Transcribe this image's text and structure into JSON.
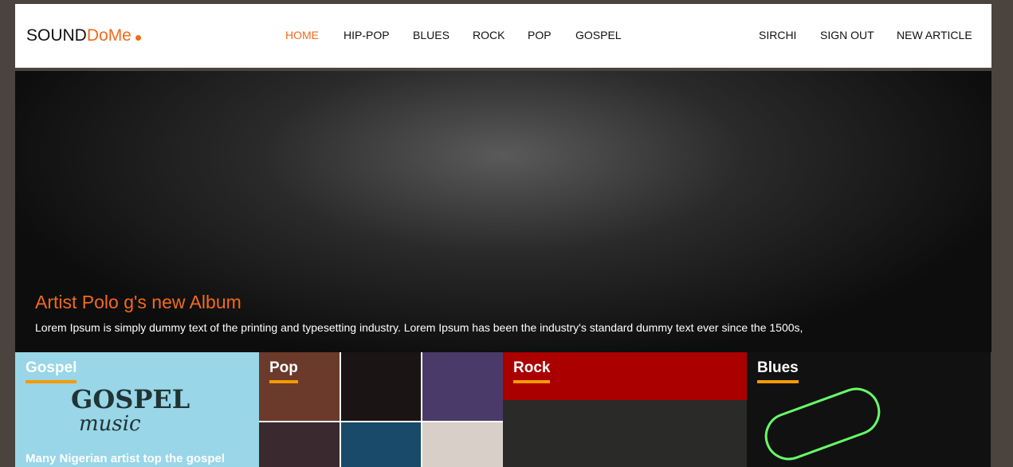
{
  "nav": {
    "logo_main": "SOUND",
    "logo_accent": "DoMe",
    "links": [
      "HOME",
      "HIP-POP",
      "BLUES",
      "ROCK",
      "POP",
      "GOSPEL"
    ],
    "right": [
      "SIRCHI",
      "SIGN OUT",
      "NEW ARTICLE"
    ],
    "active_color": "#f26a1b"
  },
  "hero": {
    "title": "Artist Polo g's new Album",
    "text": "Lorem Ipsum is simply dummy text of the printing and typesetting industry. Lorem Ipsum has been the industry's standard dummy text ever since the 1500s,"
  },
  "cards": [
    {
      "title": "Gospel",
      "desc": "Many Nigerian artist top the gospel",
      "art1": "GOSPEL",
      "art2": "music"
    },
    {
      "title": "Pop"
    },
    {
      "title": "Rock"
    },
    {
      "title": "Blues"
    }
  ]
}
